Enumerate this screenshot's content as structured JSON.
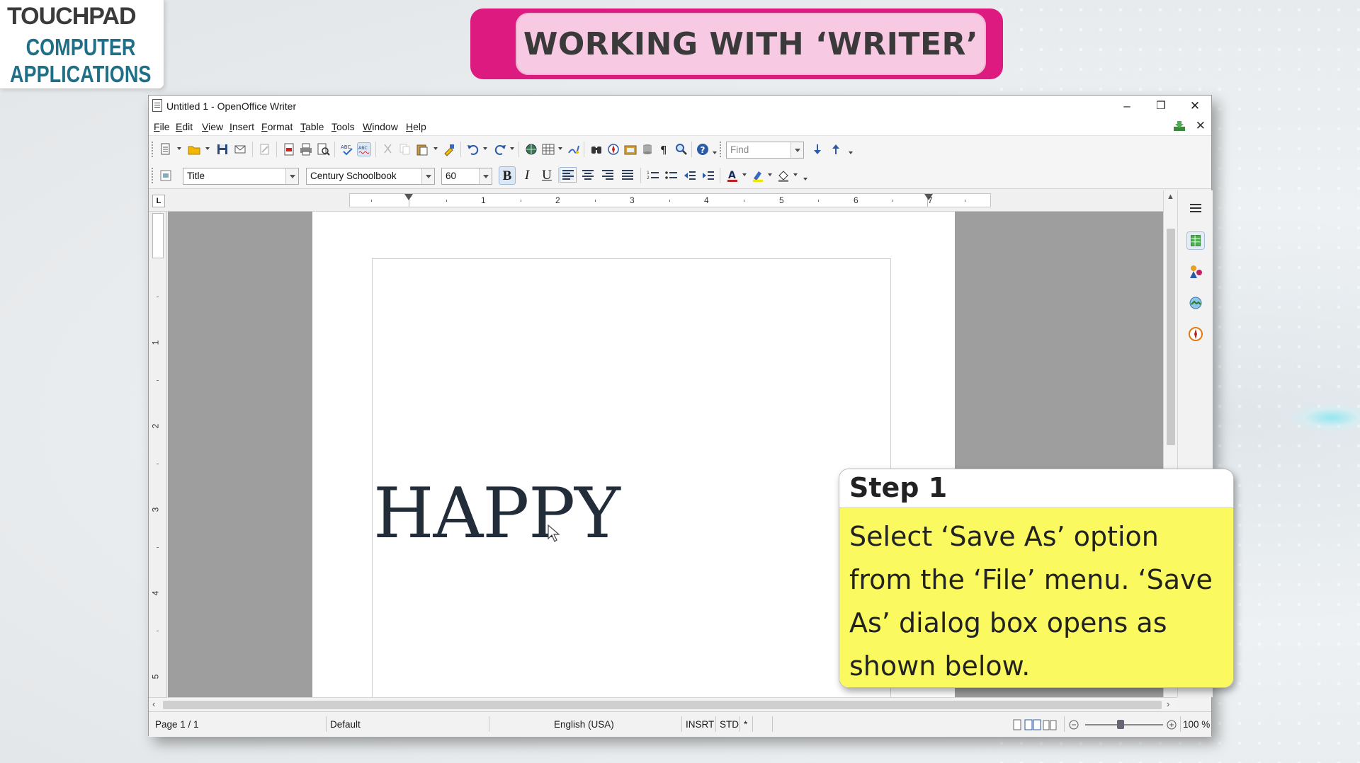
{
  "logo": {
    "line1": "TOUCHPAD",
    "line2": "COMPUTER",
    "line3": "APPLICATIONS",
    "brand_color": "#1f6f86"
  },
  "banner": {
    "text": "WORKING WITH ‘WRITER’",
    "outer_color": "#dd1a80",
    "inner_color": "#f7c9e2"
  },
  "window": {
    "title": "Untitled 1 - OpenOffice Writer",
    "controls": {
      "minimize": "–",
      "restore": "❒",
      "close": "✕"
    },
    "close_doc": "✕"
  },
  "menu": [
    "File",
    "Edit",
    "View",
    "Insert",
    "Format",
    "Table",
    "Tools",
    "Window",
    "Help"
  ],
  "toolbar": {
    "find_placeholder": "Find",
    "paragraph_style": "Title",
    "font_name": "Century Schoolbook",
    "font_size": "60",
    "bold": "B",
    "italic": "I",
    "underline": "U"
  },
  "ruler": {
    "corner": "L",
    "numbers": [
      "1",
      "2",
      "3",
      "4",
      "5",
      "6",
      "7"
    ],
    "vertical_numbers": [
      "1",
      "2",
      "3",
      "4",
      "5"
    ]
  },
  "document": {
    "text": "HAPPY"
  },
  "statusbar": {
    "page": "Page 1 / 1",
    "style": "Default",
    "language": "English (USA)",
    "insert_mode": "INSRT",
    "selection_mode": "STD",
    "modified": "*",
    "zoom": "100 %"
  },
  "callout": {
    "heading": "Step 1",
    "body": "Select ‘Save As’ option from the ‘File’ menu. ‘Save As’ dialog box opens as shown below.",
    "body_color": "#fafa60"
  },
  "icons": {
    "toolbar1": [
      "new-document-icon",
      "open-icon",
      "save-icon",
      "email-icon",
      "edit-file-icon",
      "export-pdf-icon",
      "print-icon",
      "page-preview-icon",
      "spellcheck-icon",
      "autospellcheck-icon",
      "cut-icon",
      "copy-icon",
      "paste-icon",
      "clone-formatting-icon",
      "undo-icon",
      "redo-icon",
      "hyperlink-icon",
      "table-icon",
      "draw-functions-icon",
      "find-replace-icon",
      "navigator-icon",
      "gallery-icon",
      "data-sources-icon",
      "formatting-marks-icon",
      "zoom-icon",
      "help-icon",
      "find-down-icon",
      "find-up-icon"
    ],
    "sidebar": [
      "sidebar-menu-icon",
      "properties-icon",
      "styles-icon",
      "gallery-icon",
      "navigator-icon"
    ]
  }
}
